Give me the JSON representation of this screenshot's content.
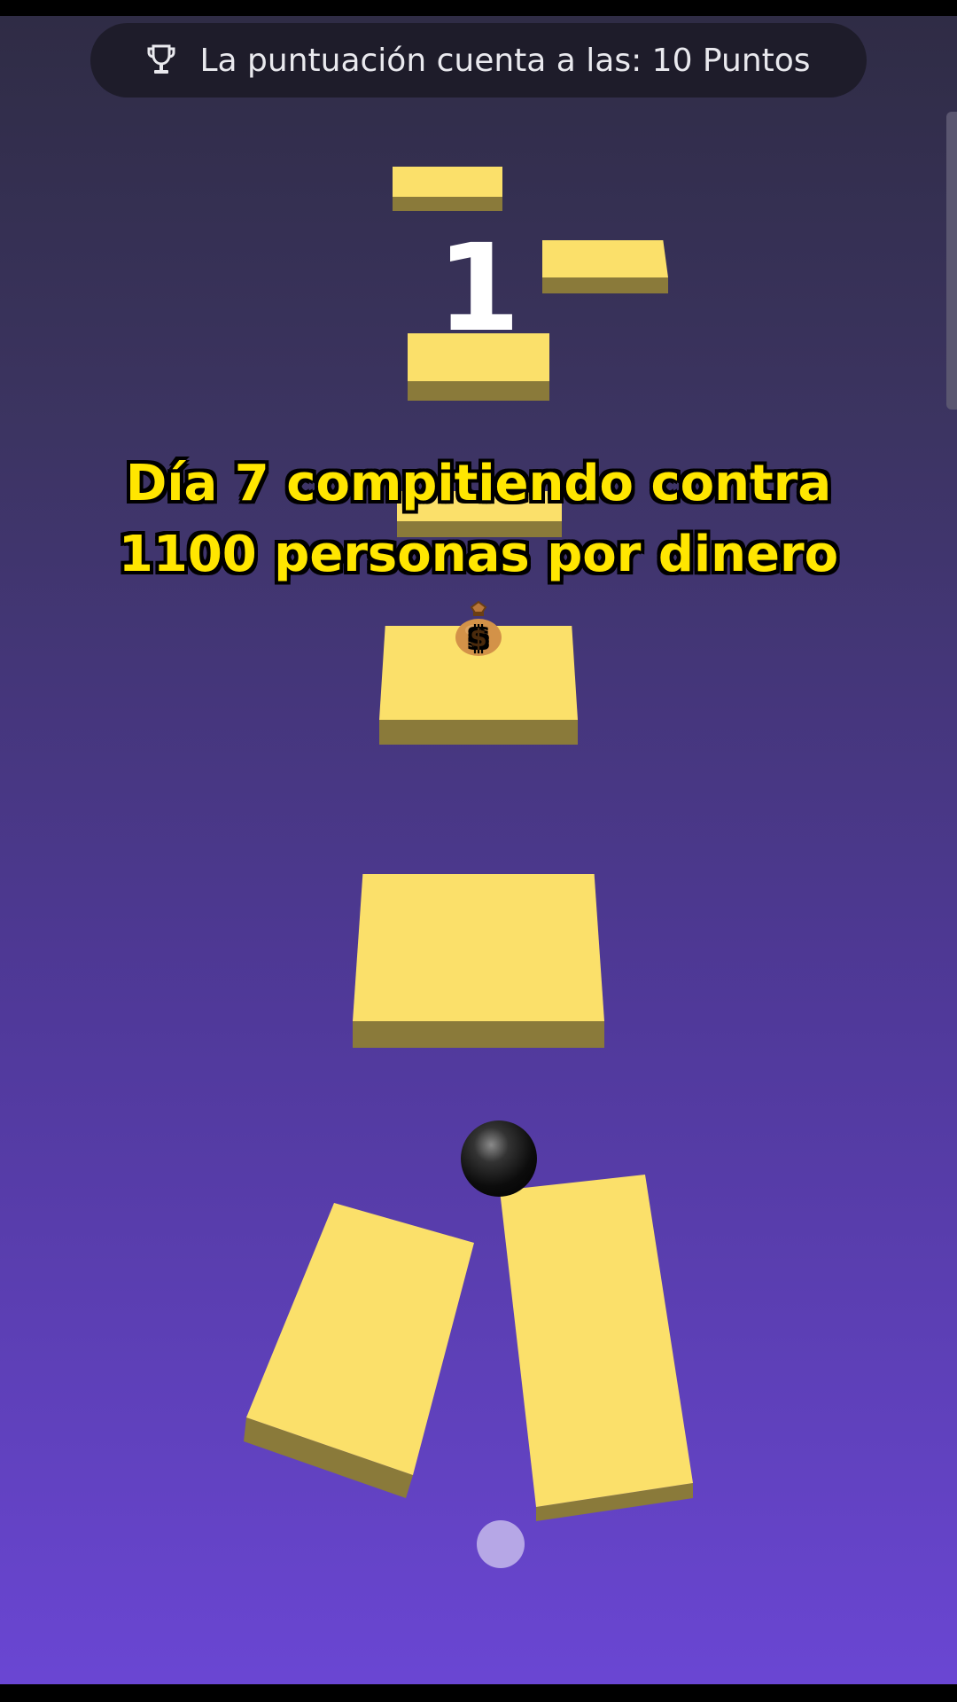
{
  "banner": {
    "icon": "trophy-icon",
    "text": "La puntuación cuenta a las: 10 Puntos"
  },
  "game": {
    "score": "1"
  },
  "caption": {
    "line1": "Día 7 compitiendo contra",
    "line2": "1100 personas por dinero",
    "emoji": "money-bag-icon"
  },
  "colors": {
    "tile_top": "#fbe06a",
    "tile_side": "#8a7a3a",
    "caption_text": "#ffe600",
    "bg_top": "#2f2c45",
    "bg_bottom": "#6a46d3"
  }
}
